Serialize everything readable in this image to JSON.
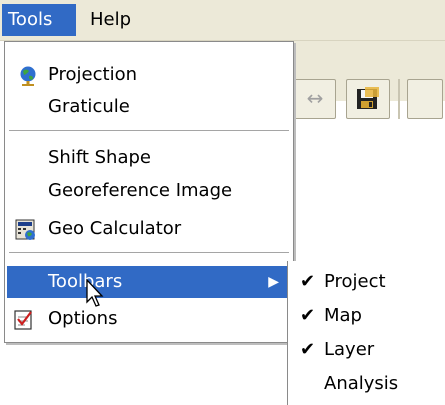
{
  "menubar": {
    "tools": "Tools",
    "help": "Help"
  },
  "toolbar": {
    "arrow_glyph": "↔"
  },
  "tools_menu": {
    "items": [
      {
        "label": "Projection",
        "icon": "globe-icon"
      },
      {
        "label": "Graticule",
        "icon": ""
      },
      {
        "label": "Shift Shape",
        "icon": ""
      },
      {
        "label": "Georeference Image",
        "icon": ""
      },
      {
        "label": "Geo Calculator",
        "icon": "calculator-icon"
      },
      {
        "label": "Toolbars",
        "icon": "",
        "has_submenu": true,
        "highlighted": true
      },
      {
        "label": "Options",
        "icon": "checklist-icon"
      }
    ],
    "submenu_arrow": "▶"
  },
  "toolbars_submenu": {
    "items": [
      {
        "label": "Project",
        "checked": true
      },
      {
        "label": "Map",
        "checked": true
      },
      {
        "label": "Layer",
        "checked": true
      },
      {
        "label": "Analysis",
        "checked": false
      }
    ],
    "check_glyph": "✔"
  },
  "colors": {
    "highlight": "#316ac5",
    "menubar_bg": "#ece9d8"
  }
}
